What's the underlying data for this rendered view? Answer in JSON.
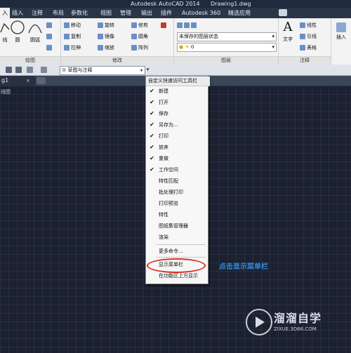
{
  "title_bar": {
    "app_title": "Autodesk AutoCAD 2014",
    "doc_title": "Drawing1.dwg"
  },
  "ribbon_tabs": [
    "入",
    "插入",
    "注释",
    "布局",
    "参数化",
    "视图",
    "管理",
    "输出",
    "插件",
    "Autodesk 360",
    "精选应用"
  ],
  "ribbon": {
    "draw": {
      "label": "绘图",
      "polyline": "线",
      "circle": "圆",
      "arc": "圆弧"
    },
    "modify": {
      "label": "修改",
      "move": "移动",
      "rotate": "旋转",
      "trim": "修剪",
      "copy": "复制",
      "mirror": "镜像",
      "fillet": "圆角",
      "stretch": "拉伸",
      "scale": "缩放",
      "array": "阵列"
    },
    "layers": {
      "label": "图层",
      "layer_state": "未保存的图层状态",
      "layer_value": "0"
    },
    "annotation": {
      "label": "注释",
      "text": "文字",
      "linear": "线性",
      "leader": "引线",
      "table": "表格"
    },
    "insert": {
      "label": "插入"
    }
  },
  "quick_access": {
    "workspace": "草图与注释"
  },
  "doc_tab": {
    "name": "g1",
    "close": "×"
  },
  "canvas": {
    "view_label": "线图"
  },
  "qa_menu": {
    "title": "自定义快速访问工具栏",
    "items": [
      {
        "label": "新建",
        "checked": "✔"
      },
      {
        "label": "打开",
        "checked": "✔"
      },
      {
        "label": "保存",
        "checked": "✔"
      },
      {
        "label": "另存为...",
        "checked": "✔"
      },
      {
        "label": "打印",
        "checked": "✔"
      },
      {
        "label": "放弃",
        "checked": "✔"
      },
      {
        "label": "重做",
        "checked": "✔"
      },
      {
        "label": "工作空间",
        "checked": "✔"
      },
      {
        "label": "特性匹配",
        "checked": ""
      },
      {
        "label": "批处理打印",
        "checked": ""
      },
      {
        "label": "打印预览",
        "checked": ""
      },
      {
        "label": "特性",
        "checked": ""
      },
      {
        "label": "图纸集管理器",
        "checked": ""
      },
      {
        "label": "渲染",
        "checked": ""
      }
    ],
    "more": "更多命令...",
    "show_menubar": "显示菜单栏",
    "show_below": "在功能区上方显示"
  },
  "annotation_text": "点击显示菜单栏",
  "watermark": {
    "main": "溜溜自学",
    "sub": "ZIXUE.3D66.COM"
  },
  "colors": {
    "highlight_ellipse": "#d6312a",
    "annotation": "#2f8ae0"
  }
}
